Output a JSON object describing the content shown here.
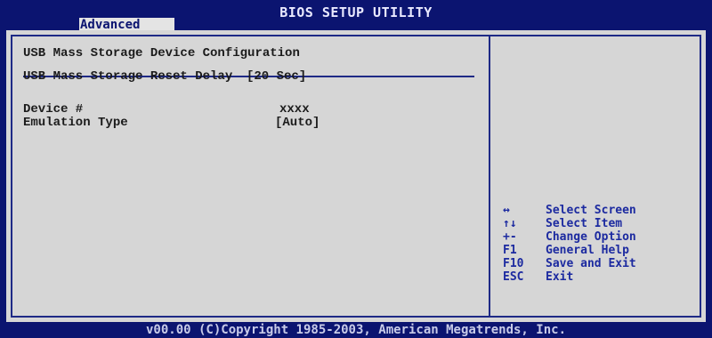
{
  "header": {
    "title": "BIOS SETUP UTILITY",
    "active_tab": "Advanced"
  },
  "main": {
    "section_title": "USB Mass Storage Device Configuration",
    "reset_delay": {
      "label": "USB Mass Storage Reset Delay",
      "value": "[20 Sec]"
    },
    "device": {
      "label": "Device #",
      "value": "xxxx"
    },
    "emulation": {
      "label": "Emulation Type",
      "value": "[Auto]"
    }
  },
  "help": {
    "items": [
      {
        "key": "↔",
        "desc": "Select Screen"
      },
      {
        "key": "↑↓",
        "desc": "Select Item"
      },
      {
        "key": "+-",
        "desc": "Change Option"
      },
      {
        "key": "F1",
        "desc": "General Help"
      },
      {
        "key": "F10",
        "desc": "Save and Exit"
      },
      {
        "key": "ESC",
        "desc": "Exit"
      }
    ]
  },
  "footer": {
    "text": "v00.00 (C)Copyright 1985-2003, American Megatrends, Inc."
  },
  "colors": {
    "background": "#0b1470",
    "panel": "#d6d6d6",
    "border": "#1e2a86",
    "help_text": "#1c2aa0",
    "tab_bg": "#e4e4e4"
  }
}
